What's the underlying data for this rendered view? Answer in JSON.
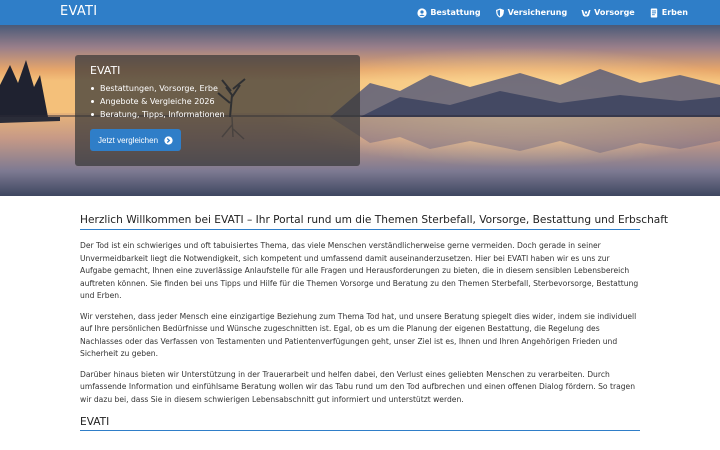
{
  "navbar": {
    "brand": "EVATI",
    "items": [
      {
        "label": "Bestattung",
        "icon": "user-circle-icon"
      },
      {
        "label": "Versicherung",
        "icon": "shield-icon"
      },
      {
        "label": "Vorsorge",
        "icon": "hands-icon"
      },
      {
        "label": "Erben",
        "icon": "document-icon"
      }
    ]
  },
  "hero": {
    "title": "EVATI",
    "bullets": [
      "Bestattungen, Vorsorge, Erbe",
      "Angebote & Vergleiche 2026",
      "Beratung, Tipps, Informationen"
    ],
    "button_label": "Jetzt vergleichen",
    "button_icon": "arrow-circle-right-icon"
  },
  "main": {
    "heading": "Herzlich Willkommen bei EVATI – Ihr Portal rund um die Themen Sterbefall, Vorsorge, Bestattung und Erbschaft",
    "paragraphs": [
      "Der Tod ist ein schwieriges und oft tabuisiertes Thema, das viele Menschen verständlicherweise gerne vermeiden. Doch gerade in seiner Unvermeidbarkeit liegt die Notwendigkeit, sich kompetent und umfassend damit auseinanderzusetzen. Hier bei EVATI haben wir es uns zur Aufgabe gemacht, Ihnen eine zuverlässige Anlaufstelle für alle Fragen und Herausforderungen zu bieten, die in diesem sensiblen Lebensbereich auftreten können. Sie finden bei uns Tipps und Hilfe für die Themen Vorsorge und Beratung zu den Themen Sterbefall, Sterbevorsorge, Bestattung und Erben.",
      "Wir verstehen, dass jeder Mensch eine einzigartige Beziehung zum Thema Tod hat, und unsere Beratung spiegelt dies wider, indem sie individuell auf Ihre persönlichen Bedürfnisse und Wünsche zugeschnitten ist. Egal, ob es um die Planung der eigenen Bestattung, die Regelung des Nachlasses oder das Verfassen von Testamenten und Patientenverfügungen geht, unser Ziel ist es, Ihnen und Ihren Angehörigen Frieden und Sicherheit zu geben.",
      "Darüber hinaus bieten wir Unterstützung in der Trauerarbeit und helfen dabei, den Verlust eines geliebten Menschen zu verarbeiten. Durch umfassende Information und einfühlsame Beratung wollen wir das Tabu rund um den Tod aufbrechen und einen offenen Dialog fördern. So tragen wir dazu bei, dass Sie in diesem schwierigen Lebensabschnitt gut informiert und unterstützt werden."
    ],
    "subheading": "EVATI"
  },
  "colors": {
    "accent": "#2f7ec8",
    "hero_box": "#373737"
  }
}
